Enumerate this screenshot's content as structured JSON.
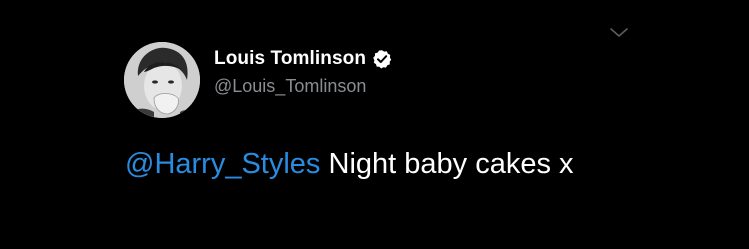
{
  "tweet": {
    "author": {
      "display_name": "Louis Tomlinson",
      "handle": "@Louis_Tomlinson",
      "verified": true
    },
    "text": {
      "mention": "@Harry_Styles",
      "body": " Night baby cakes x"
    },
    "icons": {
      "verified": "verified-badge-icon",
      "menu": "chevron-down-icon"
    },
    "colors": {
      "background": "#000000",
      "mention": "#2a8ce0",
      "handle": "#8a8d91",
      "text": "#ffffff"
    }
  }
}
